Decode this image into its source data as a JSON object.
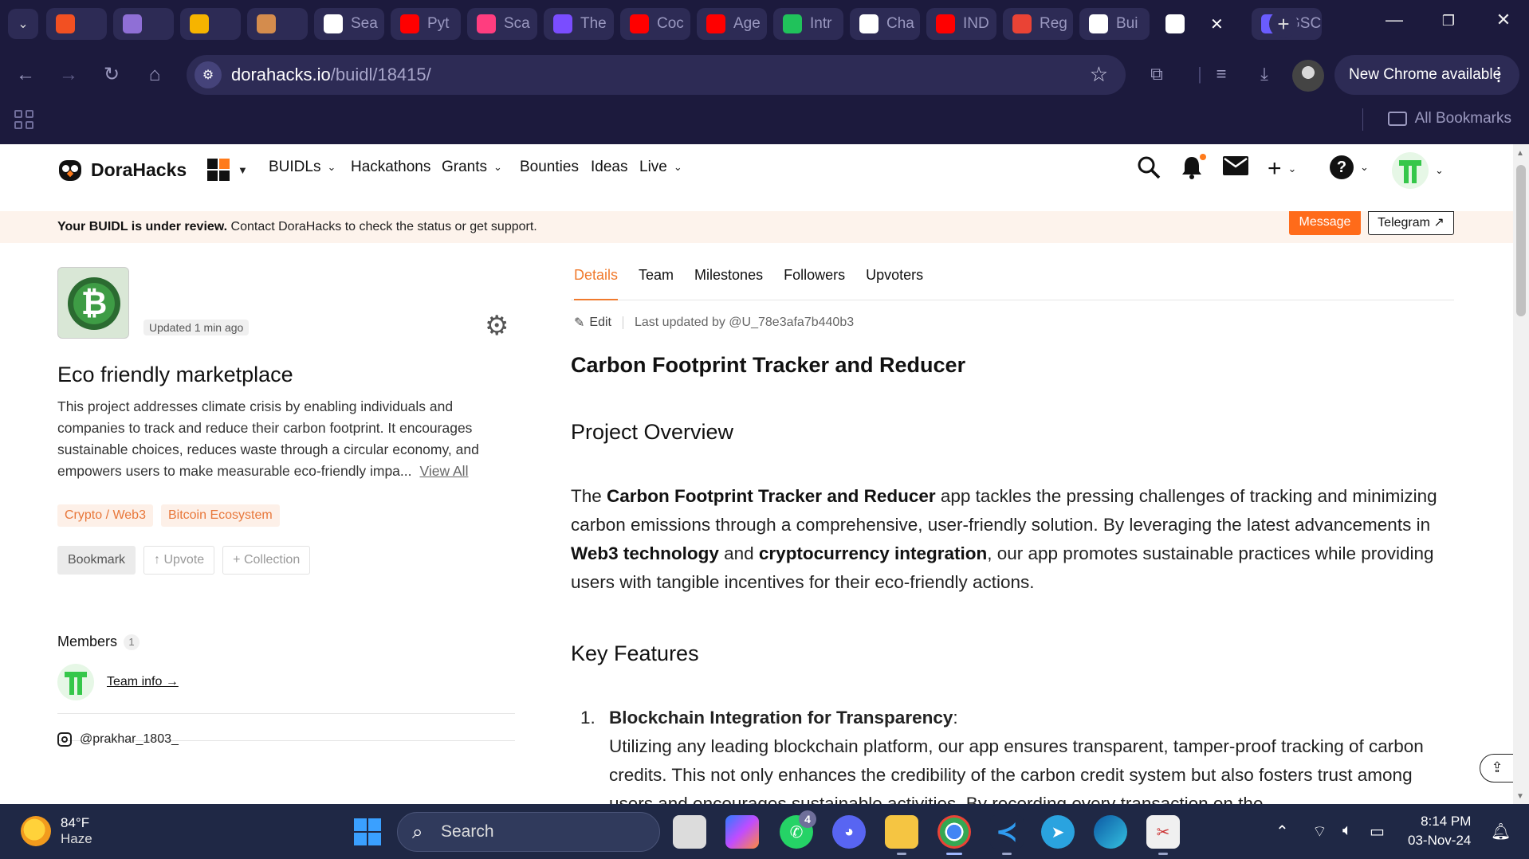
{
  "browser": {
    "tabs": [
      {
        "icon": "windows-icon",
        "label": "",
        "color": "#f25022"
      },
      {
        "icon": "avatar-icon",
        "label": "",
        "color": "#8f6fd6"
      },
      {
        "icon": "chart-icon",
        "label": "",
        "color": "#f6b400"
      },
      {
        "icon": "person-icon",
        "label": "",
        "color": "#d48c4d"
      },
      {
        "icon": "app-icon",
        "label": "Sea",
        "color": "#ffffff"
      },
      {
        "icon": "youtube-icon",
        "label": "Pyt",
        "color": "#ff0000"
      },
      {
        "icon": "t-icon",
        "label": "Sca",
        "color": "#ff3d7f"
      },
      {
        "icon": "u-icon",
        "label": "The",
        "color": "#7a4dff"
      },
      {
        "icon": "youtube-icon",
        "label": "Coc",
        "color": "#ff0000"
      },
      {
        "icon": "youtube-icon",
        "label": "Age",
        "color": "#ff0000"
      },
      {
        "icon": "w-icon",
        "label": "Intr",
        "color": "#20c25b"
      },
      {
        "icon": "openai-icon",
        "label": "Cha",
        "color": "#ffffff"
      },
      {
        "icon": "youtube-icon",
        "label": "IND",
        "color": "#ff0000"
      },
      {
        "icon": "gmail-icon",
        "label": "Reg",
        "color": "#ea4335"
      },
      {
        "icon": "dorahacks-icon",
        "label": "Bui",
        "color": "#ffffff"
      },
      {
        "icon": "dorahacks-icon",
        "label": "",
        "color": "#ffffff",
        "active": true
      },
      {
        "icon": "gsoc-icon",
        "label": "GSC",
        "color": "#6a5cff"
      }
    ],
    "url_host": "dorahacks.io",
    "url_path": "/buidl/18415/",
    "new_chrome_label": "New Chrome available",
    "all_bookmarks_label": "All Bookmarks"
  },
  "site": {
    "logo_text": "DoraHacks",
    "nav": [
      "BUIDLs",
      "Hackathons",
      "Grants",
      "Bounties",
      "Ideas",
      "Live"
    ],
    "accent_color": "#ff6b1a"
  },
  "banner": {
    "bold": "Your BUIDL is under review.",
    "text": " Contact DoraHacks to check the status or get support.",
    "message_button": "Message",
    "telegram_button": "Telegram ↗"
  },
  "project": {
    "updated": "Updated 1 min ago",
    "title": "Eco friendly marketplace",
    "description": "This project addresses climate crisis by enabling individuals and companies to track and reduce their carbon footprint. It encourages sustainable choices, reduces waste through a circular economy, and empowers users to make measurable eco-friendly impa...",
    "view_all": "View All",
    "tags": [
      "Crypto / Web3",
      "Bitcoin Ecosystem"
    ],
    "actions": {
      "bookmark": "Bookmark",
      "upvote": "↑ Upvote",
      "collection": "+ Collection"
    },
    "members_label": "Members",
    "members_count": "1",
    "team_info": "Team info →",
    "instagram": "@prakhar_1803_"
  },
  "details": {
    "tabs": [
      "Details",
      "Team",
      "Milestones",
      "Followers",
      "Upvoters"
    ],
    "edit": "Edit",
    "last_updated": "Last updated by @U_78e3afa7b440b3",
    "doc_title": "Carbon Footprint Tracker and Reducer",
    "overview_heading": "Project Overview",
    "overview": {
      "p1": "The ",
      "b1": "Carbon Footprint Tracker and Reducer",
      "p2": " app tackles the pressing challenges of tracking and minimizing carbon emissions through a comprehensive, user-friendly solution. By leveraging the latest advancements in ",
      "b2": "Web3 technology",
      "p3": " and ",
      "b3": "cryptocurrency integration",
      "p4": ", our app promotes sustainable practices while providing users with tangible incentives for their eco-friendly actions."
    },
    "features_heading": "Key Features",
    "feature1": {
      "num": "1.",
      "title": "Blockchain Integration for Transparency",
      "colon": ":",
      "text": "Utilizing any leading blockchain platform, our app ensures transparent, tamper-proof tracking of carbon credits. This not only enhances the credibility of the carbon credit system but also fosters trust among users and encourages sustainable activities. By recording every transaction on the"
    }
  },
  "taskbar": {
    "temp": "84°F",
    "condition": "Haze",
    "search_label": "Search",
    "whatsapp_badge": "4",
    "time": "8:14 PM",
    "date": "03-Nov-24"
  }
}
